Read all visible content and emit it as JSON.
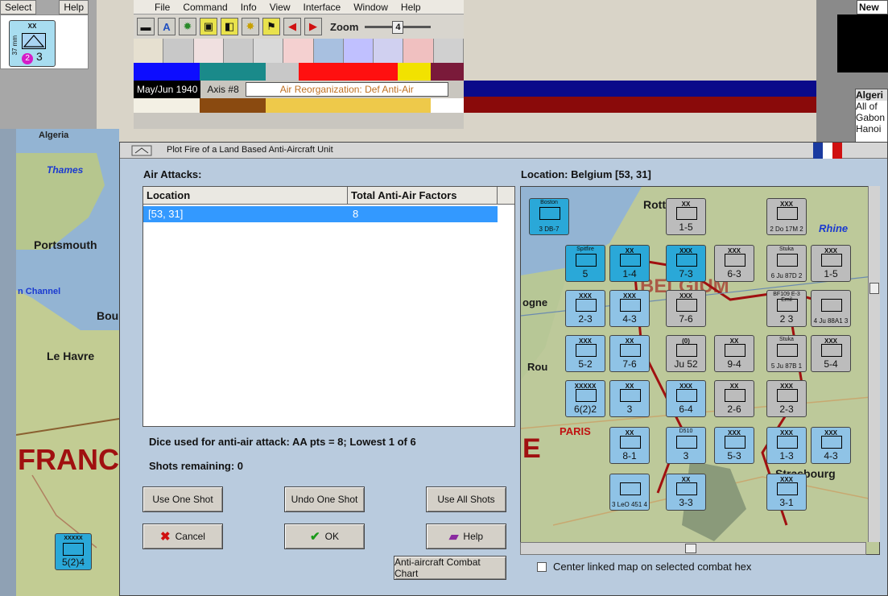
{
  "top_left_panel": {
    "tabs": [
      "Select",
      "Help"
    ],
    "unit": {
      "size": "XX",
      "side_label": "37 mm",
      "values": "3",
      "badge": "2"
    }
  },
  "menubar": {
    "items": [
      "File",
      "Command",
      "Info",
      "View",
      "Interface",
      "Window",
      "Help"
    ]
  },
  "toolbar": {
    "zoom_label": "Zoom",
    "zoom_value": "4",
    "tools": [
      {
        "icon": "tank-icon",
        "glyph": "▬"
      },
      {
        "icon": "font-a-icon",
        "glyph": "A"
      },
      {
        "icon": "gear-icon",
        "glyph": "✹"
      },
      {
        "icon": "hq-icon",
        "glyph": "▣"
      },
      {
        "icon": "unit-box-icon",
        "glyph": "◧"
      },
      {
        "icon": "burst-icon",
        "glyph": "✸"
      },
      {
        "icon": "flag-icon",
        "glyph": "⚑"
      },
      {
        "icon": "arrow-left-icon",
        "glyph": "◀"
      },
      {
        "icon": "arrow-right-icon",
        "glyph": "▶"
      }
    ]
  },
  "status": {
    "date": "May/Jun 1940",
    "turn": "Axis #8",
    "phase": "Air Reorganization: Def Anti-Air"
  },
  "colors": {
    "flags": [
      "#e6e0d0",
      "#c8c8c8",
      "#f0e0e0",
      "#c9c9c9",
      "#d9d9d9",
      "#f4d0d0",
      "#a8c0e0",
      "#c0c0ff",
      "#d0d0f0",
      "#f0c0c0",
      "#d0d0d0"
    ],
    "stripe_row": [
      "#0d0dff",
      "#0d0dff",
      "#1a8a8a",
      "#1a8a8a",
      "#c8c8c8",
      "#ff1010",
      "#ff1010",
      "#ff1010",
      "#f2e200",
      "#7a1a3a"
    ],
    "bar_row": [
      "#f3f0e4",
      "#f3f0e4",
      "#8a4a10",
      "#8a4a10",
      "#eec94a",
      "#eec94a",
      "#eec94a",
      "#eec94a",
      "#eec94a",
      "#ffffff"
    ],
    "right_stripes": [
      "#0a0a8a",
      "#8a0a0a"
    ]
  },
  "right_panel": {
    "new_tab": "New c",
    "list_header": "Algeri",
    "list_items": [
      "All of",
      "Gabon",
      "Hanoi"
    ]
  },
  "left_map": {
    "title": "Algeria",
    "labels": [
      "Thames",
      "Portsmouth",
      "n Channel",
      "Bou",
      "Le Havre",
      "FRANC"
    ],
    "unit_values": "5(2)4",
    "unit_size": "XXXXX"
  },
  "dialog": {
    "title": "Plot Fire of a Land Based Anti-Aircraft Unit",
    "air_attacks_label": "Air Attacks:",
    "table": {
      "headers": [
        "Location",
        "Total Anti-Air Factors"
      ],
      "rows": [
        {
          "location": "[53, 31]",
          "factors": "8"
        }
      ]
    },
    "location_heading": "Location: Belgium [53, 31]",
    "dice_text": "Dice used for anti-air attack:  AA pts = 8; Lowest 1 of 6",
    "shots_text": "Shots remaining:  0",
    "buttons": {
      "use_one": "Use One Shot",
      "undo_one": "Undo One Shot",
      "use_all": "Use All Shots",
      "cancel": "Cancel",
      "ok": "OK",
      "help": "Help",
      "chart": "Anti-aircraft Combat Chart"
    },
    "checkbox_label": "Center linked map on selected combat hex"
  },
  "map": {
    "place_labels": [
      "Rotterd",
      "Rhine",
      "BELGIUM",
      "ogne",
      "Rou",
      "PARIS",
      "Strasbourg",
      "E"
    ],
    "units": [
      {
        "name": "Boston",
        "size": "",
        "vals": "3 DB-7",
        "col": "#2aa8d8"
      },
      {
        "name": "",
        "size": "XX",
        "vals": "1-5",
        "col": "#bcbcbc"
      },
      {
        "name": "",
        "size": "XXX",
        "vals": "2 Do 17M 2",
        "col": "#bcbcbc"
      },
      {
        "name": "Spitfire",
        "size": "",
        "vals": "5",
        "col": "#2aa8d8"
      },
      {
        "name": "",
        "size": "XX",
        "vals": "1-4",
        "col": "#2aa8d8"
      },
      {
        "name": "",
        "size": "XXX",
        "vals": "7-3",
        "col": "#2aa8d8"
      },
      {
        "name": "",
        "size": "XXX",
        "vals": "6-3",
        "col": "#bcbcbc"
      },
      {
        "name": "Stuka",
        "size": "",
        "vals": "6 Ju 87D 2",
        "col": "#bcbcbc"
      },
      {
        "name": "",
        "size": "XXX",
        "vals": "1-5",
        "col": "#bcbcbc"
      },
      {
        "name": "",
        "size": "XXX",
        "vals": "2-3",
        "col": "#8fc3e6"
      },
      {
        "name": "",
        "size": "XXX",
        "vals": "4-3",
        "col": "#8fc3e6"
      },
      {
        "name": "",
        "size": "XXX",
        "vals": "7-6",
        "col": "#bcbcbc"
      },
      {
        "name": "BF109 E-3 Emil",
        "size": "",
        "vals": "2 3",
        "col": "#bcbcbc"
      },
      {
        "name": "",
        "size": "",
        "vals": "4 Ju 88A1 3",
        "col": "#bcbcbc"
      },
      {
        "name": "",
        "size": "XXX",
        "vals": "5-2",
        "col": "#8fc3e6"
      },
      {
        "name": "",
        "size": "XX",
        "vals": "7-6",
        "col": "#8fc3e6"
      },
      {
        "name": "",
        "size": "(0)",
        "vals": "Ju 52",
        "col": "#bcbcbc"
      },
      {
        "name": "",
        "size": "XX",
        "vals": "9-4",
        "col": "#bcbcbc"
      },
      {
        "name": "Stuka",
        "size": "",
        "vals": "5 Ju 87B 1",
        "col": "#bcbcbc"
      },
      {
        "name": "",
        "size": "XXX",
        "vals": "5-4",
        "col": "#bcbcbc"
      },
      {
        "name": "",
        "size": "XXXXX",
        "vals": "6(2)2",
        "col": "#8fc3e6"
      },
      {
        "name": "",
        "size": "XX",
        "vals": "3",
        "col": "#8fc3e6"
      },
      {
        "name": "",
        "size": "XXX",
        "vals": "6-4",
        "col": "#8fc3e6"
      },
      {
        "name": "",
        "size": "XX",
        "vals": "2-6",
        "col": "#bcbcbc"
      },
      {
        "name": "",
        "size": "XXX",
        "vals": "2-3",
        "col": "#bcbcbc"
      },
      {
        "name": "",
        "size": "XX",
        "vals": "8-1",
        "col": "#8fc3e6"
      },
      {
        "name": "D510",
        "size": "",
        "vals": "3",
        "col": "#8fc3e6"
      },
      {
        "name": "",
        "size": "XXX",
        "vals": "5-3",
        "col": "#8fc3e6"
      },
      {
        "name": "",
        "size": "XXX",
        "vals": "1-3",
        "col": "#8fc3e6"
      },
      {
        "name": "",
        "size": "XXX",
        "vals": "4-3",
        "col": "#8fc3e6"
      },
      {
        "name": "",
        "size": "",
        "vals": "3 LeO 451 4",
        "col": "#8fc3e6"
      },
      {
        "name": "",
        "size": "XX",
        "vals": "3-3",
        "col": "#8fc3e6"
      },
      {
        "name": "",
        "size": "XXX",
        "vals": "3-1",
        "col": "#8fc3e6"
      }
    ]
  }
}
